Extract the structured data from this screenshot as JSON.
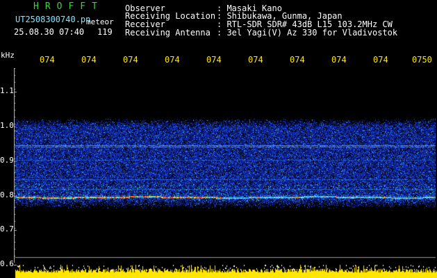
{
  "header": {
    "app_title": "HROFFT",
    "filename": "UT2508300740.pn",
    "meteor_label": "meteor",
    "datetime": "25.08.30 07:40",
    "meteor_count": "119"
  },
  "meta": [
    {
      "label": "Observer",
      "value": ": Masaki Kano"
    },
    {
      "label": "Receiving Location",
      "value": ": Shibukawa, Gunma, Japan"
    },
    {
      "label": "Receiver",
      "value": ": RTL-SDR SDR# 43dB L15 103.2MHz CW"
    },
    {
      "label": "Receiving Antenna",
      "value": ": 3el Yagi(V) Az 330 for Vladivostok"
    }
  ],
  "axis": {
    "unit": "kHz",
    "freq_ticks": [
      {
        "label": "1.1",
        "value": 1.1
      },
      {
        "label": "1.0",
        "value": 1.0
      },
      {
        "label": "0.9",
        "value": 0.9
      },
      {
        "label": "0.8",
        "value": 0.8
      },
      {
        "label": "0.7",
        "value": 0.7
      },
      {
        "label": "0.6",
        "value": 0.6
      }
    ],
    "time_ticks": [
      "074",
      "074",
      "074",
      "074",
      "074",
      "074",
      "074",
      "074",
      "074",
      "0750"
    ]
  },
  "colors": {
    "background": "#000000",
    "title": "#3fd13f",
    "filename": "#7fe6ff",
    "time_ticks": "#ffe600",
    "signal_peak": "#ff3b00",
    "noise_low": "#0a1f8f",
    "noise_high": "#2f6bff",
    "bar": "#ffe600"
  }
}
